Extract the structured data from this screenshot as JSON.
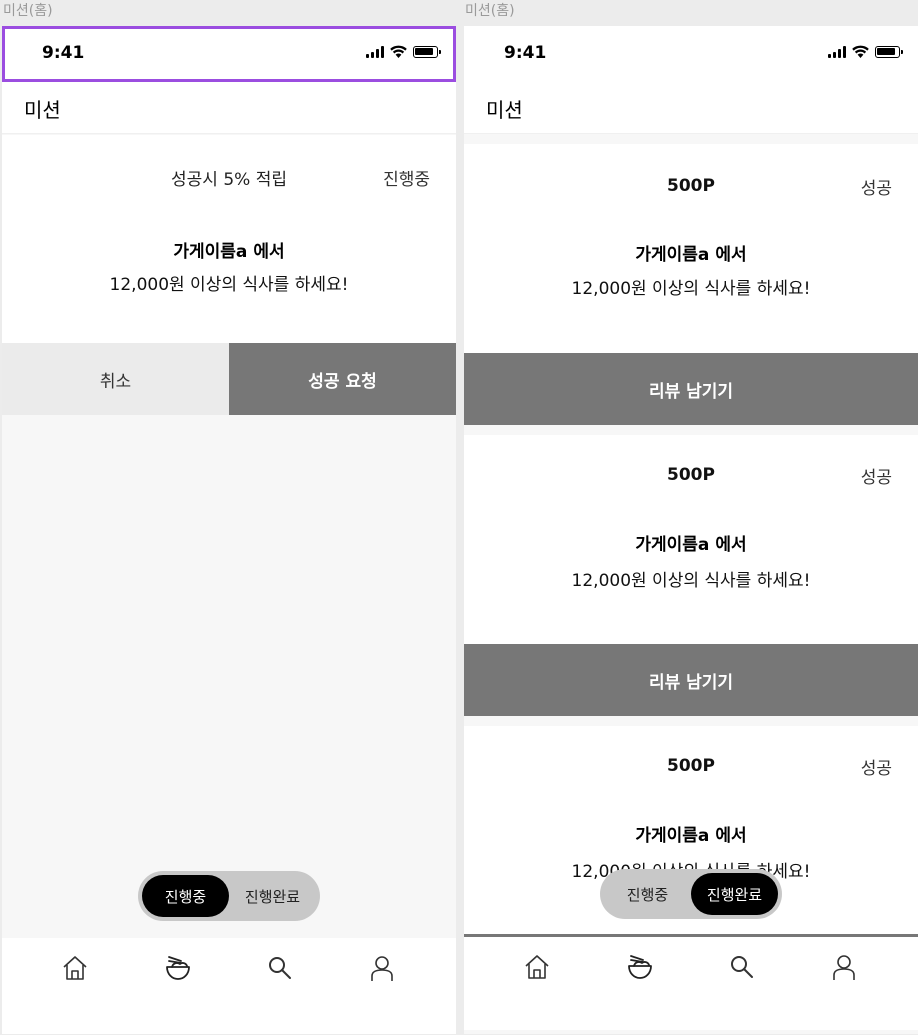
{
  "screens": [
    {
      "frame_label": "미션(홈)",
      "status_time": "9:41",
      "page_title": "미션",
      "card": {
        "reward": "성공시 5% 적립",
        "status": "진행중",
        "store": "가게이름a 에서",
        "desc": "12,000원 이상의 식사를 하세요!"
      },
      "cancel_label": "취소",
      "success_label": "성공 요청",
      "toggle": {
        "option_1": "진행중",
        "option_2": "진행완료",
        "active": "진행중"
      }
    },
    {
      "frame_label": "미션(홈)",
      "status_time": "9:41",
      "page_title": "미션",
      "cards": [
        {
          "reward": "500P",
          "status": "성공",
          "store": "가게이름a 에서",
          "desc": "12,000원 이상의 식사를 하세요!",
          "button": "리뷰 남기기"
        },
        {
          "reward": "500P",
          "status": "성공",
          "store": "가게이름a 에서",
          "desc": "12,000원 이상의 식사를 하세요!",
          "button": "리뷰 남기기"
        },
        {
          "reward": "500P",
          "status": "성공",
          "store": "가게이름a 에서",
          "desc": "12,000원 이상의 식사를 하세요!"
        }
      ],
      "toggle": {
        "option_1": "진행중",
        "option_2": "진행완료",
        "active": "진행완료"
      }
    }
  ],
  "tabbar": {
    "icons": [
      "home-icon",
      "bowl-icon",
      "search-icon",
      "profile-icon"
    ]
  },
  "colors": {
    "selection_outline": "#9b4de0",
    "dark_button": "#777777",
    "toggle_active": "#000000"
  }
}
